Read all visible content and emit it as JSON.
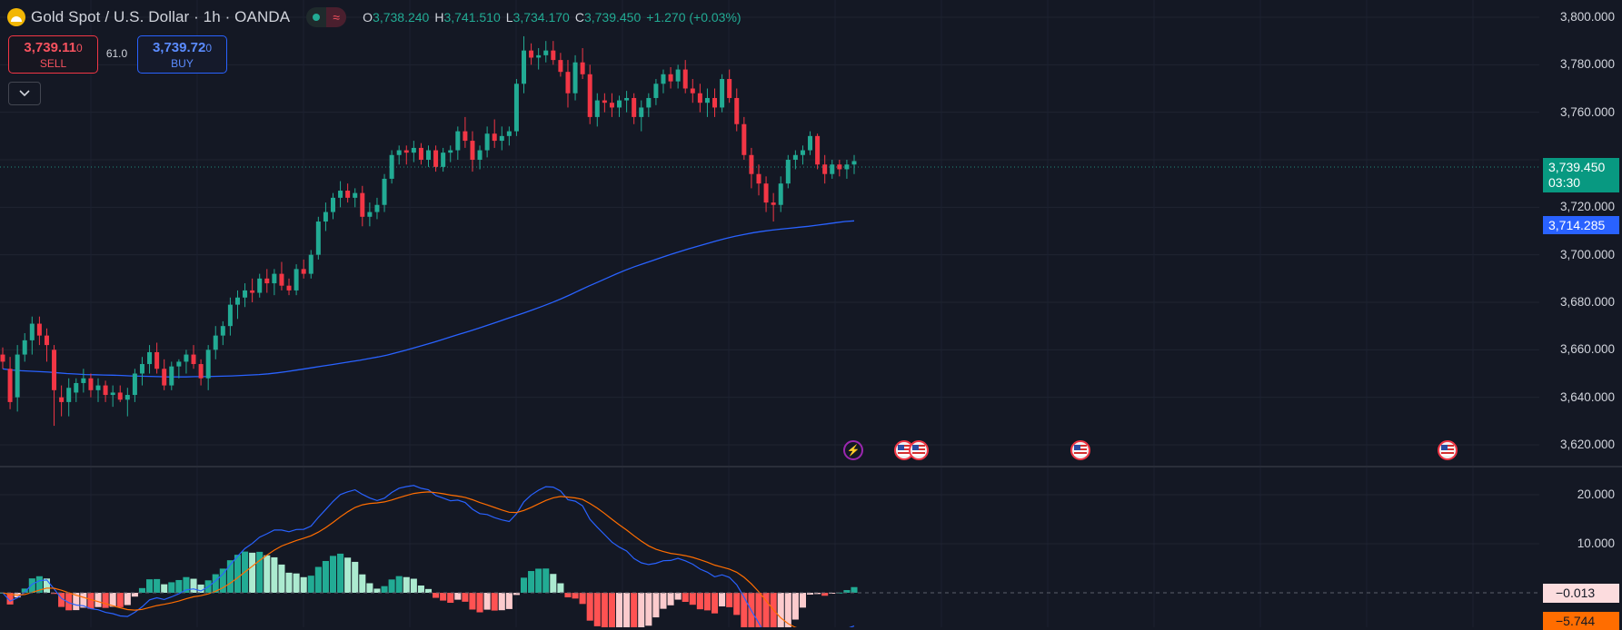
{
  "header": {
    "symbol_title": "Gold Spot / U.S. Dollar · 1h · OANDA",
    "status_wave": "≈",
    "ohlc": [
      {
        "label": "O",
        "value": "3,738.240"
      },
      {
        "label": "H",
        "value": "3,741.510"
      },
      {
        "label": "L",
        "value": "3,734.170"
      },
      {
        "label": "C",
        "value": "3,739.450"
      }
    ],
    "change": "+1.270 (+0.03%)"
  },
  "trading": {
    "sell_price_main": "3,739.11",
    "sell_price_sub": "0",
    "sell_label": "SELL",
    "buy_price_main": "3,739.72",
    "buy_price_sub": "0",
    "buy_label": "BUY",
    "spread": "61.0",
    "collapse_icon": "chevron-down-icon"
  },
  "price_axis": {
    "labels": [
      "3,800.000",
      "3,780.000",
      "3,760.000",
      "3,720.000",
      "3,700.000",
      "3,680.000",
      "3,660.000",
      "3,640.000",
      "3,620.000"
    ],
    "current_price": "3,739.450",
    "countdown": "03:30",
    "ma_value": "3,714.285"
  },
  "macd_axis": {
    "labels": [
      "20.000",
      "10.000"
    ],
    "histogram_value": "−0.013",
    "macd_value": "−5.744"
  },
  "events": [
    {
      "type": "bolt",
      "icon": "lightning-icon"
    },
    {
      "type": "flag",
      "icon": "us-flag-icon"
    },
    {
      "type": "flag",
      "icon": "us-flag-icon"
    },
    {
      "type": "flag",
      "icon": "us-flag-icon"
    },
    {
      "type": "flag",
      "icon": "us-flag-icon"
    }
  ],
  "colors": {
    "background": "#141824",
    "up": "#22ab94",
    "down": "#f23645",
    "ma": "#2962ff",
    "macd_line": "#2962ff",
    "signal_line": "#ff6d00",
    "hist_up_strong": "#22ab94",
    "hist_up_weak": "#acead0",
    "hist_down_strong": "#ff5252",
    "hist_down_weak": "#fccbcd"
  },
  "chart_data": {
    "type": "candlestick",
    "ylim": [
      3612,
      3806
    ],
    "candles": [
      [
        3658,
        3661,
        3652,
        3655
      ],
      [
        3652,
        3657,
        3635,
        3638
      ],
      [
        3640,
        3662,
        3634,
        3658
      ],
      [
        3658,
        3667,
        3655,
        3664
      ],
      [
        3664,
        3674,
        3658,
        3671
      ],
      [
        3671,
        3674,
        3662,
        3666
      ],
      [
        3666,
        3669,
        3655,
        3662
      ],
      [
        3660,
        3662,
        3628,
        3643
      ],
      [
        3640,
        3645,
        3632,
        3638
      ],
      [
        3638,
        3648,
        3632,
        3644
      ],
      [
        3642,
        3648,
        3638,
        3646
      ],
      [
        3646,
        3652,
        3642,
        3648
      ],
      [
        3648,
        3650,
        3640,
        3643
      ],
      [
        3643,
        3648,
        3638,
        3645
      ],
      [
        3645,
        3647,
        3638,
        3641
      ],
      [
        3641,
        3645,
        3636,
        3642
      ],
      [
        3642,
        3645,
        3638,
        3639
      ],
      [
        3639,
        3644,
        3632,
        3641
      ],
      [
        3641,
        3652,
        3638,
        3650
      ],
      [
        3650,
        3657,
        3645,
        3654
      ],
      [
        3654,
        3662,
        3650,
        3659
      ],
      [
        3659,
        3663,
        3650,
        3652
      ],
      [
        3652,
        3656,
        3643,
        3645
      ],
      [
        3645,
        3655,
        3643,
        3653
      ],
      [
        3653,
        3656,
        3648,
        3655
      ],
      [
        3655,
        3660,
        3650,
        3658
      ],
      [
        3658,
        3662,
        3652,
        3654
      ],
      [
        3654,
        3656,
        3645,
        3648
      ],
      [
        3648,
        3662,
        3643,
        3660
      ],
      [
        3660,
        3670,
        3656,
        3666
      ],
      [
        3666,
        3672,
        3662,
        3670
      ],
      [
        3670,
        3682,
        3666,
        3679
      ],
      [
        3679,
        3685,
        3673,
        3682
      ],
      [
        3682,
        3688,
        3678,
        3685
      ],
      [
        3685,
        3690,
        3680,
        3684
      ],
      [
        3684,
        3692,
        3682,
        3690
      ],
      [
        3690,
        3694,
        3684,
        3688
      ],
      [
        3688,
        3694,
        3683,
        3692
      ],
      [
        3692,
        3697,
        3685,
        3687
      ],
      [
        3687,
        3690,
        3683,
        3685
      ],
      [
        3685,
        3696,
        3683,
        3694
      ],
      [
        3694,
        3698,
        3690,
        3692
      ],
      [
        3692,
        3702,
        3690,
        3700
      ],
      [
        3700,
        3716,
        3698,
        3714
      ],
      [
        3714,
        3722,
        3710,
        3718
      ],
      [
        3718,
        3726,
        3715,
        3724
      ],
      [
        3724,
        3731,
        3720,
        3727
      ],
      [
        3727,
        3730,
        3722,
        3724
      ],
      [
        3724,
        3728,
        3720,
        3726
      ],
      [
        3726,
        3729,
        3712,
        3716
      ],
      [
        3716,
        3722,
        3712,
        3718
      ],
      [
        3718,
        3724,
        3715,
        3721
      ],
      [
        3721,
        3734,
        3718,
        3732
      ],
      [
        3732,
        3744,
        3730,
        3742
      ],
      [
        3742,
        3746,
        3738,
        3744
      ],
      [
        3744,
        3746,
        3738,
        3743
      ],
      [
        3743,
        3748,
        3739,
        3745
      ],
      [
        3745,
        3747,
        3738,
        3740
      ],
      [
        3740,
        3746,
        3737,
        3744
      ],
      [
        3744,
        3746,
        3735,
        3737
      ],
      [
        3737,
        3745,
        3735,
        3743
      ],
      [
        3743,
        3746,
        3739,
        3744
      ],
      [
        3744,
        3754,
        3740,
        3752
      ],
      [
        3752,
        3758,
        3745,
        3748
      ],
      [
        3748,
        3752,
        3735,
        3740
      ],
      [
        3740,
        3746,
        3736,
        3744
      ],
      [
        3744,
        3754,
        3741,
        3751
      ],
      [
        3751,
        3757,
        3745,
        3748
      ],
      [
        3748,
        3754,
        3744,
        3750
      ],
      [
        3750,
        3754,
        3746,
        3752
      ],
      [
        3752,
        3774,
        3750,
        3772
      ],
      [
        3772,
        3792,
        3768,
        3786
      ],
      [
        3786,
        3789,
        3780,
        3783
      ],
      [
        3783,
        3787,
        3778,
        3784
      ],
      [
        3784,
        3790,
        3781,
        3786
      ],
      [
        3786,
        3790,
        3780,
        3782
      ],
      [
        3782,
        3785,
        3775,
        3777
      ],
      [
        3777,
        3782,
        3762,
        3768
      ],
      [
        3768,
        3784,
        3765,
        3781
      ],
      [
        3781,
        3787,
        3774,
        3776
      ],
      [
        3776,
        3780,
        3755,
        3758
      ],
      [
        3758,
        3768,
        3754,
        3765
      ],
      [
        3765,
        3768,
        3760,
        3764
      ],
      [
        3764,
        3768,
        3758,
        3762
      ],
      [
        3762,
        3767,
        3758,
        3765
      ],
      [
        3765,
        3769,
        3760,
        3766
      ],
      [
        3766,
        3768,
        3755,
        3758
      ],
      [
        3758,
        3765,
        3752,
        3762
      ],
      [
        3762,
        3768,
        3758,
        3766
      ],
      [
        3766,
        3774,
        3763,
        3772
      ],
      [
        3772,
        3778,
        3768,
        3776
      ],
      [
        3776,
        3779,
        3770,
        3773
      ],
      [
        3773,
        3780,
        3770,
        3778
      ],
      [
        3778,
        3782,
        3768,
        3770
      ],
      [
        3770,
        3774,
        3764,
        3768
      ],
      [
        3768,
        3772,
        3760,
        3764
      ],
      [
        3764,
        3770,
        3758,
        3766
      ],
      [
        3766,
        3770,
        3758,
        3762
      ],
      [
        3762,
        3776,
        3760,
        3774
      ],
      [
        3774,
        3778,
        3764,
        3766
      ],
      [
        3766,
        3770,
        3752,
        3755
      ],
      [
        3755,
        3758,
        3740,
        3742
      ],
      [
        3742,
        3745,
        3728,
        3734
      ],
      [
        3734,
        3738,
        3725,
        3730
      ],
      [
        3730,
        3733,
        3718,
        3722
      ],
      [
        3722,
        3726,
        3714,
        3721
      ],
      [
        3721,
        3733,
        3718,
        3730
      ],
      [
        3730,
        3742,
        3728,
        3740
      ],
      [
        3740,
        3744,
        3736,
        3742
      ],
      [
        3742,
        3746,
        3738,
        3744
      ],
      [
        3744,
        3752,
        3742,
        3750
      ],
      [
        3750,
        3751,
        3736,
        3738
      ],
      [
        3738,
        3742,
        3730,
        3734
      ],
      [
        3734,
        3740,
        3732,
        3738
      ],
      [
        3738,
        3740,
        3733,
        3736
      ],
      [
        3736,
        3740,
        3732,
        3738
      ],
      [
        3738,
        3742,
        3734,
        3739.45
      ]
    ],
    "ma": [
      3652,
      3651.5,
      3651.2,
      3651,
      3650.8,
      3650.6,
      3650.3,
      3650,
      3649.8,
      3649.6,
      3649.5,
      3649.4,
      3649.3,
      3649.2,
      3649,
      3648.9,
      3648.8,
      3648.7,
      3648.6,
      3648.6,
      3648.6,
      3648.7,
      3648.7,
      3648.8,
      3648.9,
      3649,
      3649.2,
      3649.4,
      3649.6,
      3649.9,
      3650.3,
      3650.8,
      3651.4,
      3652,
      3652.6,
      3653.2,
      3653.8,
      3654.4,
      3655,
      3655.6,
      3656.3,
      3657,
      3657.8,
      3658.8,
      3659.8,
      3660.9,
      3662,
      3663.1,
      3664.3,
      3665.5,
      3666.7,
      3667.9,
      3669.1,
      3670.4,
      3671.7,
      3673,
      3674.3,
      3675.6,
      3677,
      3678.4,
      3679.9,
      3681.5,
      3683.2,
      3685,
      3686.8,
      3688.5,
      3690.2,
      3691.9,
      3693.5,
      3695,
      3696.3,
      3697.6,
      3698.9,
      3700.2,
      3701.4,
      3702.6,
      3703.7,
      3704.8,
      3705.9,
      3706.9,
      3707.8,
      3708.6,
      3709.3,
      3709.9,
      3710.4,
      3710.8,
      3711.2,
      3711.6,
      3712,
      3712.5,
      3713,
      3713.5,
      3714,
      3714.285
    ]
  }
}
